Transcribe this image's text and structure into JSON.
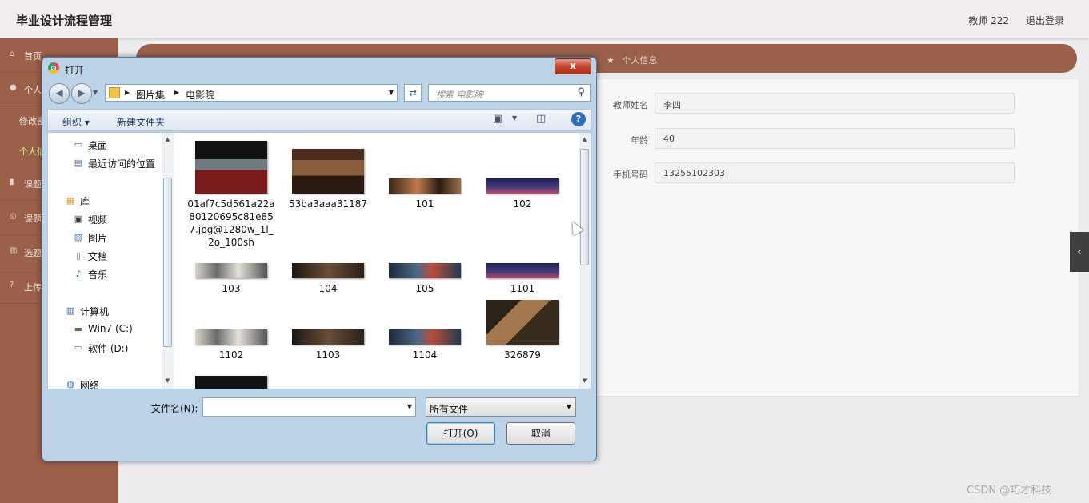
{
  "header": {
    "title": "毕业设计流程管理",
    "user": "教师 222",
    "logout": "退出登录"
  },
  "sidebar": {
    "items": [
      {
        "icon": "home-icon",
        "label": "首页"
      },
      {
        "icon": "user-icon",
        "label": "个人"
      },
      {
        "icon": "microphone-icon",
        "label": "课题"
      },
      {
        "icon": "compass-icon",
        "label": "课题"
      },
      {
        "icon": "bar-chart-icon",
        "label": "选题"
      },
      {
        "icon": "question-icon",
        "label": "上传"
      }
    ],
    "subitems": [
      "修改密",
      "个人信"
    ]
  },
  "breadcrumb": {
    "star": "★",
    "current": "个人信息"
  },
  "profile": {
    "fields": [
      {
        "label": "教师姓名",
        "value": "李四"
      },
      {
        "label": "年龄",
        "value": "40"
      },
      {
        "label": "手机号码",
        "value": "13255102303"
      }
    ]
  },
  "toggle_glyph": "‹",
  "watermark": "CSDN @巧才科技",
  "dialog": {
    "title": "打开",
    "close_glyph": "x",
    "path": [
      "图片集",
      "电影院"
    ],
    "search_placeholder": "搜索 电影院",
    "toolbar": {
      "organize": "组织 ▾",
      "new_folder": "新建文件夹"
    },
    "nav_tree": [
      {
        "icon": "desktop-icon",
        "label": "桌面",
        "indent": 1
      },
      {
        "icon": "recent-places-icon",
        "label": "最近访问的位置",
        "indent": 1
      },
      {
        "icon": "library-icon",
        "label": "库",
        "indent": 0
      },
      {
        "icon": "video-icon",
        "label": "视频",
        "indent": 1
      },
      {
        "icon": "picture-icon",
        "label": "图片",
        "indent": 1
      },
      {
        "icon": "document-icon",
        "label": "文档",
        "indent": 1
      },
      {
        "icon": "music-icon",
        "label": "音乐",
        "indent": 1
      },
      {
        "icon": "computer-icon",
        "label": "计算机",
        "indent": 0
      },
      {
        "icon": "drive-c-icon",
        "label": "Win7 (C:)",
        "indent": 1
      },
      {
        "icon": "drive-d-icon",
        "label": "软件 (D:)",
        "indent": 1
      },
      {
        "icon": "network-icon",
        "label": "网络",
        "indent": 0
      }
    ],
    "files": [
      {
        "name": "01af7c5d561a22a80120695c81e857.jpg@1280w_1l_2o_100sh",
        "thumb": "cinema-dark"
      },
      {
        "name": "53ba3aaa31187",
        "thumb": "cinema-brown"
      },
      {
        "name": "101",
        "thumb": "banner-crowd"
      },
      {
        "name": "102",
        "thumb": "banner-night"
      },
      {
        "name": "103",
        "thumb": "banner-light"
      },
      {
        "name": "104",
        "thumb": "banner-dark"
      },
      {
        "name": "105",
        "thumb": "banner-blue"
      },
      {
        "name": "1101",
        "thumb": "banner-night"
      },
      {
        "name": "1102",
        "thumb": "banner-light"
      },
      {
        "name": "1103",
        "thumb": "banner-dark"
      },
      {
        "name": "1104",
        "thumb": "banner-blue"
      },
      {
        "name": "326879",
        "thumb": "cinema-room"
      },
      {
        "name": "",
        "thumb": "cinema-dark"
      },
      {
        "name": "",
        "thumb": "banner-light"
      },
      {
        "name": "",
        "thumb": "banner-dark"
      },
      {
        "name": "",
        "thumb": "banner-night"
      }
    ],
    "filename_label": "文件名(N):",
    "filename_value": "",
    "filetype": "所有文件",
    "open_button": "打开(O)",
    "cancel_button": "取消"
  },
  "colors": {
    "sidebar": "#9a6049",
    "active_sub": "#d9ff8a",
    "dialog_frame": "#bcd2e7",
    "close_button": "#c44531"
  }
}
